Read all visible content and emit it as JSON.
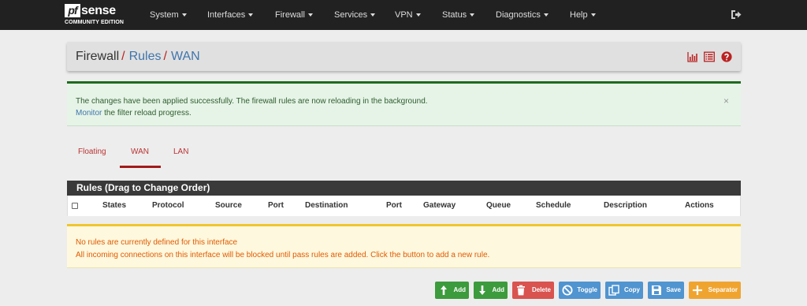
{
  "nav": {
    "logo_mark": "pf",
    "logo_text": "sense",
    "logo_sub": "COMMUNITY EDITION",
    "menus": [
      "System",
      "Interfaces",
      "Firewall",
      "Services",
      "VPN",
      "Status",
      "Diagnostics",
      "Help"
    ],
    "logout_icon": "sign-out-icon"
  },
  "breadcrumb": {
    "root": "Firewall",
    "separator": "/",
    "level2": "Rules",
    "level3": "WAN",
    "icons": [
      "bar-chart-icon",
      "list-icon",
      "help-icon"
    ]
  },
  "alert": {
    "line1": "The changes have been applied successfully. The firewall rules are now reloading in the background.",
    "link": "Monitor",
    "line2_rest": " the filter reload progress.",
    "close": "×"
  },
  "tabs": [
    {
      "label": "Floating",
      "active": false
    },
    {
      "label": "WAN",
      "active": true
    },
    {
      "label": "LAN",
      "active": false
    }
  ],
  "rules_table": {
    "title": "Rules (Drag to Change Order)",
    "columns": [
      "States",
      "Protocol",
      "Source",
      "Port",
      "Destination",
      "Port",
      "Gateway",
      "Queue",
      "Schedule",
      "Description",
      "Actions"
    ]
  },
  "warning": {
    "line1": "No rules are currently defined for this interface",
    "line2": "All incoming connections on this interface will be blocked until pass rules are added. Click the button to add a new rule."
  },
  "buttons": [
    {
      "label": "Add",
      "icon": "arrow-up-icon",
      "color": "#3c9b3c"
    },
    {
      "label": "Add",
      "icon": "arrow-down-icon",
      "color": "#3c9b3c"
    },
    {
      "label": "Delete",
      "icon": "trash-icon",
      "color": "#d9534f"
    },
    {
      "label": "Toggle",
      "icon": "ban-icon",
      "color": "#5094d0"
    },
    {
      "label": "Copy",
      "icon": "copy-icon",
      "color": "#5094d0"
    },
    {
      "label": "Save",
      "icon": "save-icon",
      "color": "#5094d0"
    },
    {
      "label": "Separator",
      "icon": "plus-icon",
      "color": "#f0a430"
    }
  ],
  "colors": {
    "nav_bg": "#212121",
    "accent_red": "#a21a1a",
    "link_blue": "#3f75ad",
    "success_bg": "#e6f4e7",
    "warning_bg": "#fdf8de",
    "warning_text": "#e25a00"
  }
}
